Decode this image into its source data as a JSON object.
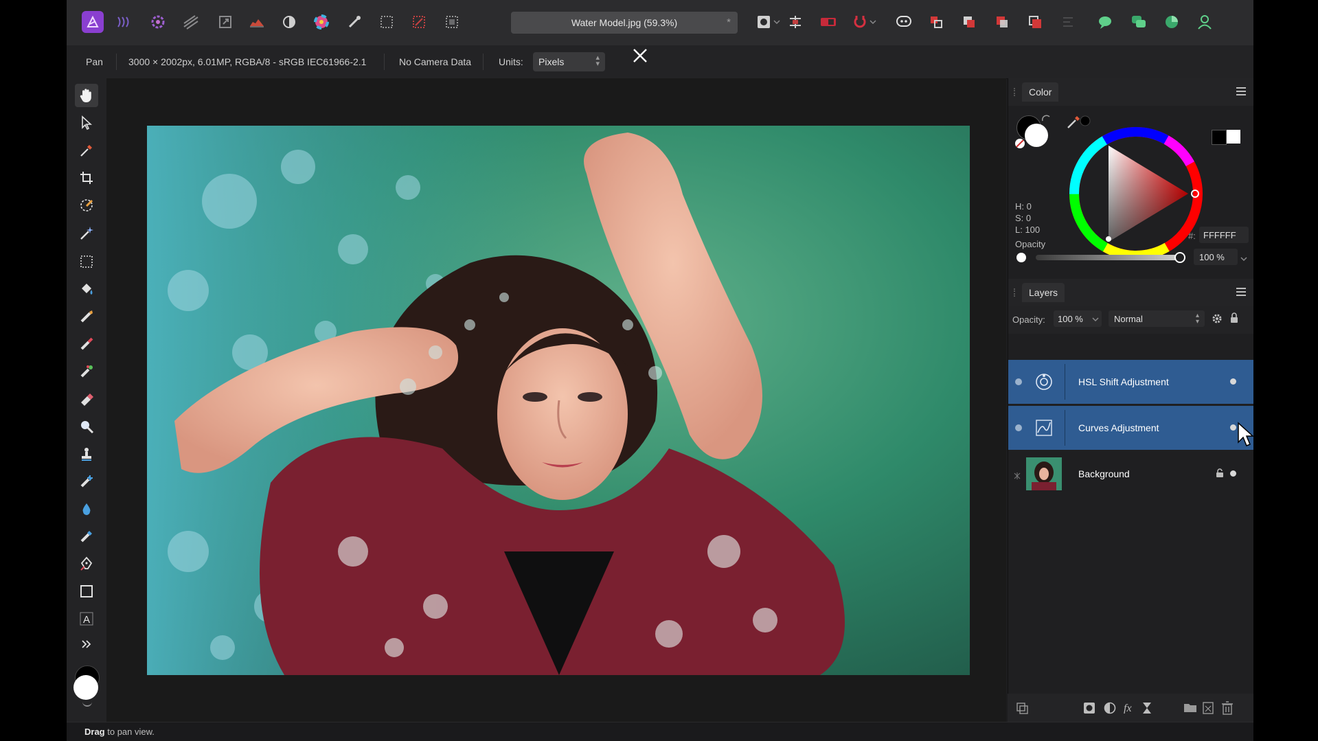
{
  "toolbar_top": {
    "document_title": "Water Model.jpg (59.3%)",
    "modified_marker": "*"
  },
  "context": {
    "tool_name": "Pan",
    "image_info": "3000 × 2002px, 6.01MP, RGBA/8 - sRGB IEC61966-2.1",
    "camera": "No Camera Data",
    "units_label": "Units:",
    "units_value": "Pixels"
  },
  "color_panel": {
    "title": "Color",
    "h": "H: 0",
    "s": "S: 0",
    "l": "L: 100",
    "hex_label": "#:",
    "hex_value": "FFFFFF",
    "opacity_label": "Opacity",
    "opacity_value": "100 %",
    "opacity_level": 1.0
  },
  "layers_panel": {
    "title": "Layers",
    "opacity_label": "Opacity:",
    "opacity_value": "100 %",
    "blend_mode": "Normal",
    "layers": [
      {
        "name": "HSL Shift Adjustment",
        "selected": true
      },
      {
        "name": "Curves Adjustment",
        "selected": true
      },
      {
        "name": "Background",
        "selected": false
      }
    ]
  },
  "status": {
    "action": "Drag",
    "hint": " to pan view."
  },
  "colors": {
    "accent_selection": "#2f5c92",
    "app_bg": "#1d1d1f",
    "persona_icon": "#9b4fd6"
  },
  "icons": {
    "tools": [
      "hand-icon",
      "move-icon",
      "color-picker-icon",
      "crop-icon",
      "selection-brush-icon",
      "magic-wand-icon",
      "marquee-icon",
      "flood-fill-icon",
      "paint-brush-icon",
      "pixel-brush-icon",
      "mixer-brush-icon",
      "erase-brush-icon",
      "dodge-icon",
      "clone-stamp-icon",
      "healing-brush-icon",
      "blur-icon",
      "inpainting-icon",
      "pen-icon",
      "rectangle-icon",
      "text-icon",
      "expand-icon"
    ]
  }
}
